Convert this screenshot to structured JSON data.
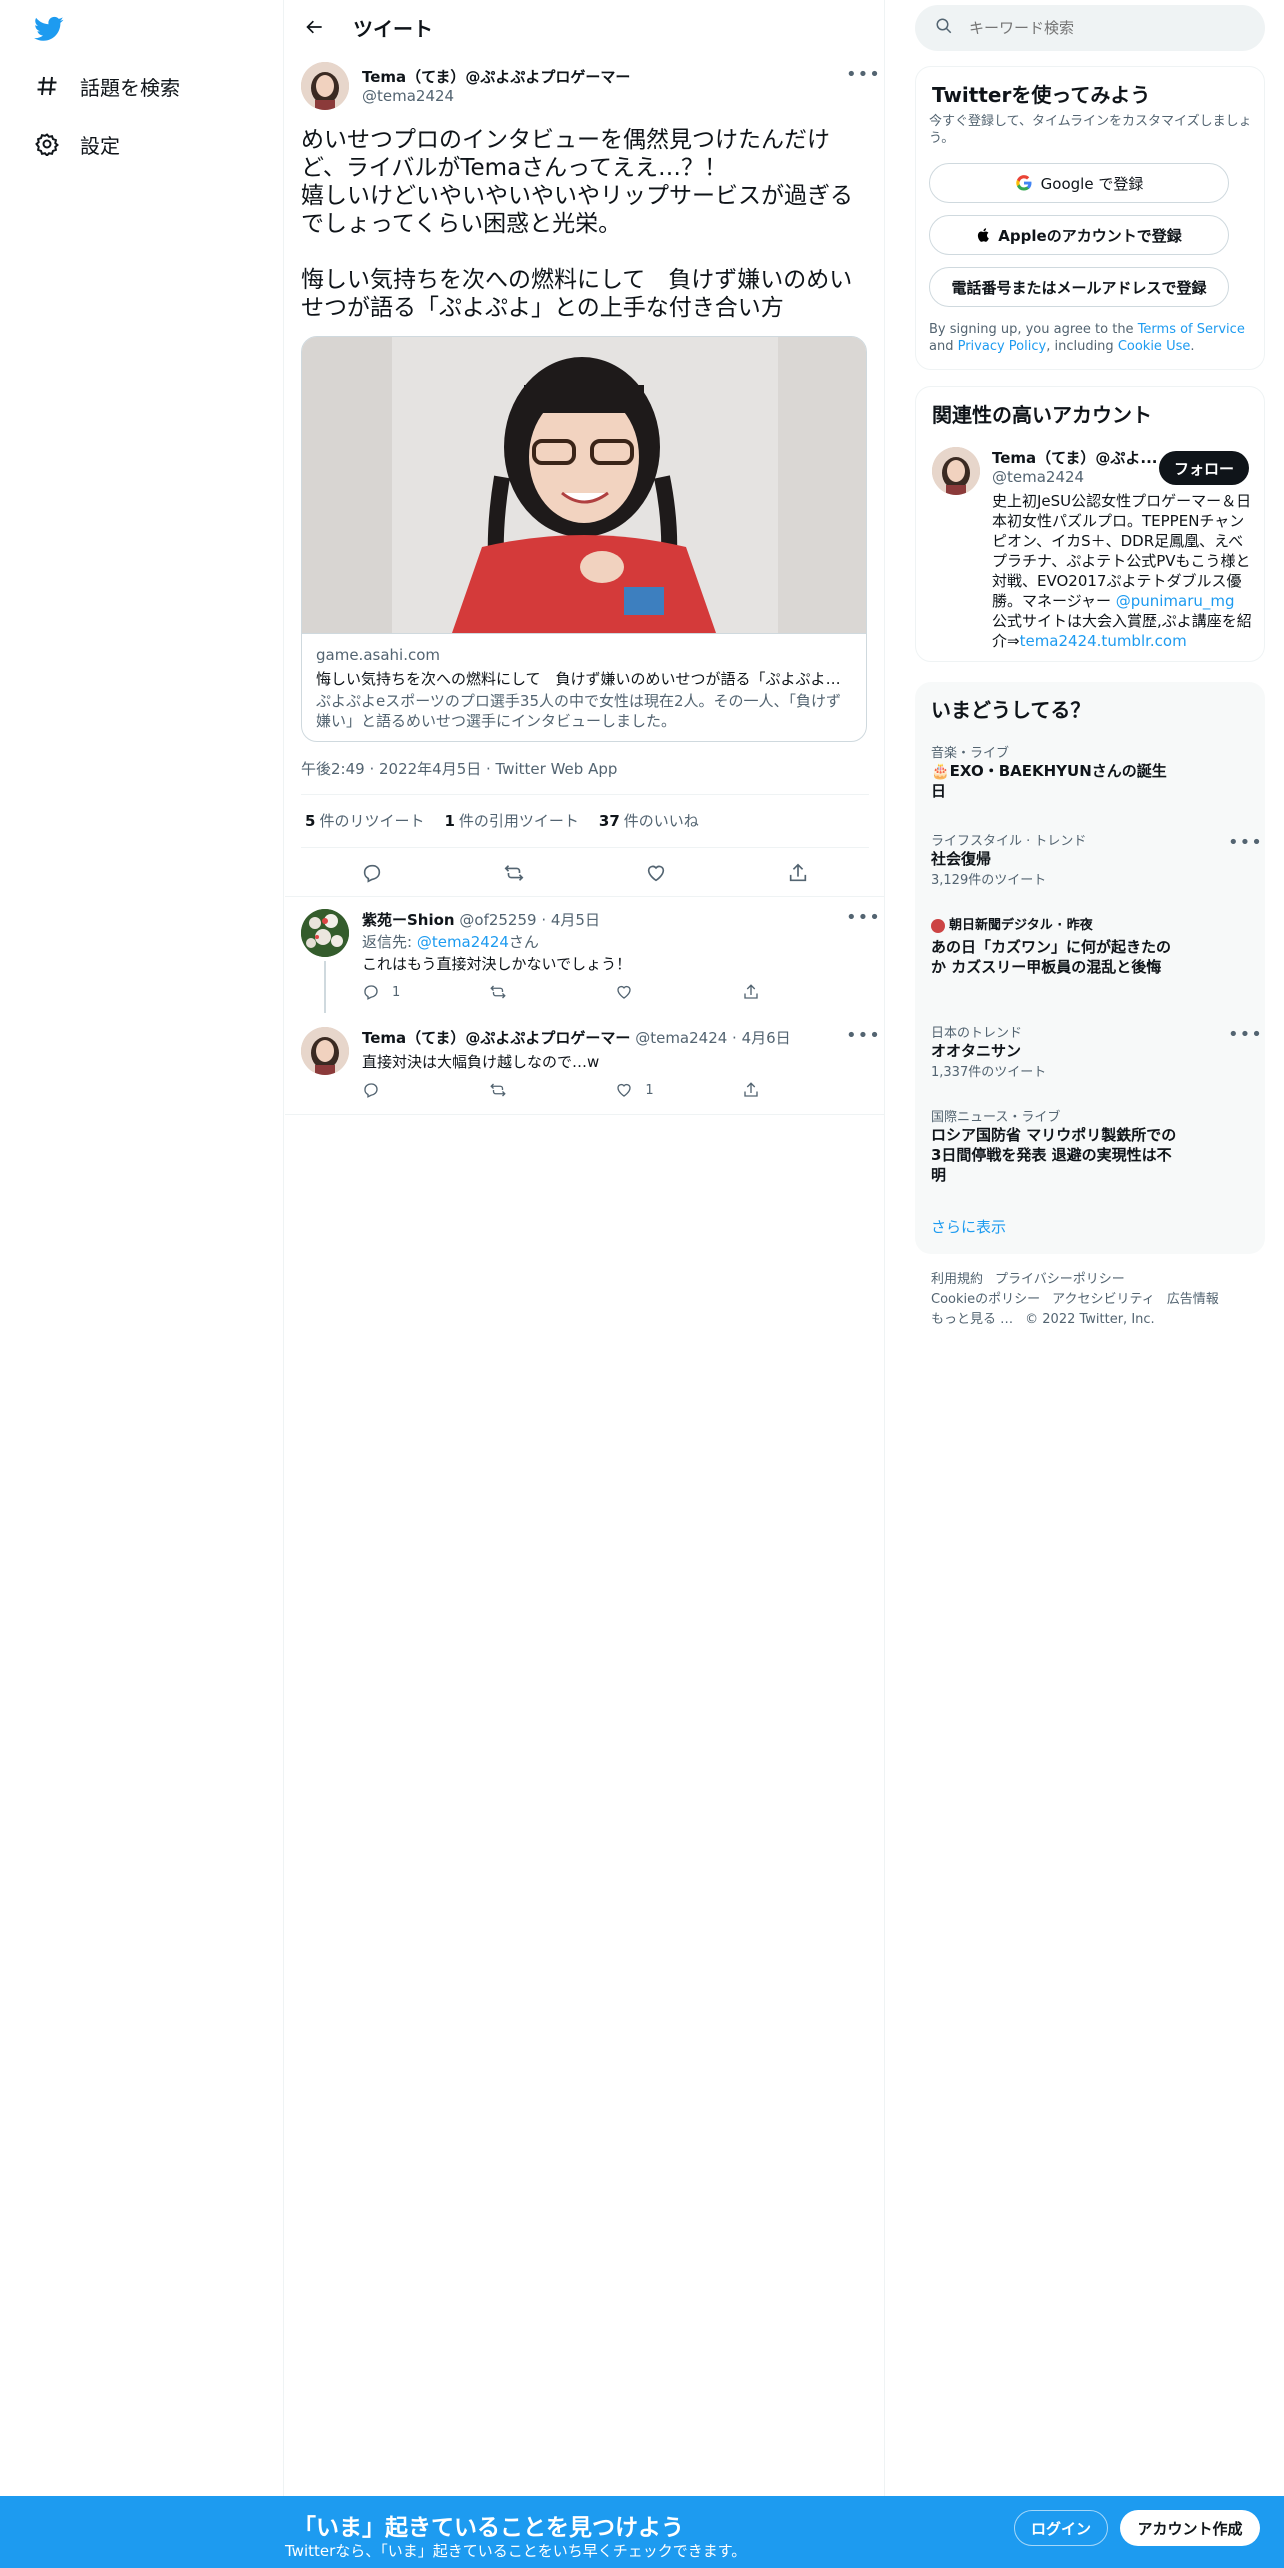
{
  "nav": {
    "explore_label": "話題を検索",
    "settings_label": "設定"
  },
  "header": {
    "title": "ツイート"
  },
  "tweet": {
    "author_name": "Tema（てま）@ぷよぷよプロゲーマー",
    "author_handle": "@tema2424",
    "text": "めいせつプロのインタビューを偶然見つけたんだけど、ライバルがTemaさんってええ…？！\n嬉しいけどいやいやいやいやリップサービスが過ぎるでしょってくらい困惑と光栄。\n\n悔しい気持ちを次への燃料にして　負けず嫌いのめいせつが語る「ぷよぷよ」との上手な付き合い方",
    "card_domain": "game.asahi.com",
    "card_title": "悔しい気持ちを次への燃料にして　負けず嫌いのめいせつが語る「ぷよぷよ」...",
    "card_desc": "ぷよぷよeスポーツのプロ選手35人の中で女性は現在2人。その一人、「負けず嫌い」と語るめいせつ選手にインタビューしました。",
    "meta": "午後2:49 · 2022年4月5日 · Twitter Web App",
    "retweets_count": "5",
    "retweets_label": "件のリツイート",
    "quotes_count": "1",
    "quotes_label": "件の引用ツイート",
    "likes_count": "37",
    "likes_label": "件のいいね"
  },
  "replies": [
    {
      "name": "紫苑ーShion",
      "handle_date": "@of25259 · 4月5日",
      "reply_to_prefix": "返信先: ",
      "reply_to_handle": "@tema2424",
      "reply_to_suffix": "さん",
      "text": "これはもう直接対決しかないでしょう！",
      "reply_count": "1",
      "retweet_count": "",
      "like_count": ""
    },
    {
      "name": "Tema（てま）@ぷよぷよプロゲーマー",
      "handle_date": "@tema2424 · 4月6日",
      "text": "直接対決は大幅負け越しなので…w",
      "reply_count": "",
      "retweet_count": "",
      "like_count": "1"
    }
  ],
  "search": {
    "placeholder": "キーワード検索"
  },
  "signup": {
    "title": "Twitterを使ってみよう",
    "subtitle": "今すぐ登録して、タイムラインをカスタマイズしましょう。",
    "google_label": "Google で登録",
    "apple_label": "Appleのアカウントで登録",
    "phone_label": "電話番号またはメールアドレスで登録",
    "terms_prefix": "By signing up, you agree to the ",
    "terms_link": "Terms of Service",
    "terms_and": " and ",
    "privacy_link": "Privacy Policy",
    "terms_including": ", including ",
    "cookie_link": "Cookie Use",
    "terms_end": "."
  },
  "related": {
    "title": "関連性の高いアカウント",
    "name": "Tema（てま）@ぷよ...",
    "handle": "@tema2424",
    "follow_label": "フォロー",
    "bio_1": "史上初JeSU公認女性プロゲーマー＆日本初女性パズルプロ。TEPPENチャンピオン、イカS＋、DDR足鳳凰、えべプラチナ、ぷよテト公式PVもこう様と対戦、EVO2017ぷよテトダブルス優勝。マネージャー ",
    "bio_link_1": "@punimaru_mg",
    "bio_2": " 公式サイトは大会入賞歴,ぷよ講座を紹介⇒",
    "bio_link_2": "tema2424.tumblr.com"
  },
  "trends": {
    "title": "いまどうしてる？",
    "items": [
      {
        "category": "音楽・ライブ",
        "name": "🎂EXO・BAEKHYUNさんの誕生日",
        "count": ""
      },
      {
        "category": "ライフスタイル · トレンド",
        "name": "社会復帰",
        "count": "3,129件のツイート"
      },
      {
        "category": "朝日新聞デジタル · 昨夜",
        "name": "あの日「カズワン」に何が起きたのか カズスリー甲板員の混乱と後悔",
        "count": ""
      },
      {
        "category": "日本のトレンド",
        "name": "オオタニサン",
        "count": "1,337件のツイート"
      },
      {
        "category": "国際ニュース・ライブ",
        "name": "ロシア国防省 マリウポリ製鉄所での3日間停戦を発表 退避の実現性は不明",
        "count": ""
      }
    ],
    "more_label": "さらに表示"
  },
  "footer": {
    "terms": "利用規約",
    "privacy": "プライバシーポリシー",
    "cookie": "Cookieのポリシー",
    "accessibility": "アクセシビリティ",
    "ads": "広告情報",
    "more": "もっと見る …",
    "copyright": "© 2022 Twitter, Inc."
  },
  "banner": {
    "title": "「いま」起きていることを見つけよう",
    "subtitle": "Twitterなら、「いま」起きていることをいち早くチェックできます。",
    "login_label": "ログイン",
    "signup_label": "アカウント作成"
  },
  "colors": {
    "accent": "#1d9bf0",
    "text": "#0f1419",
    "secondary": "#536471"
  }
}
